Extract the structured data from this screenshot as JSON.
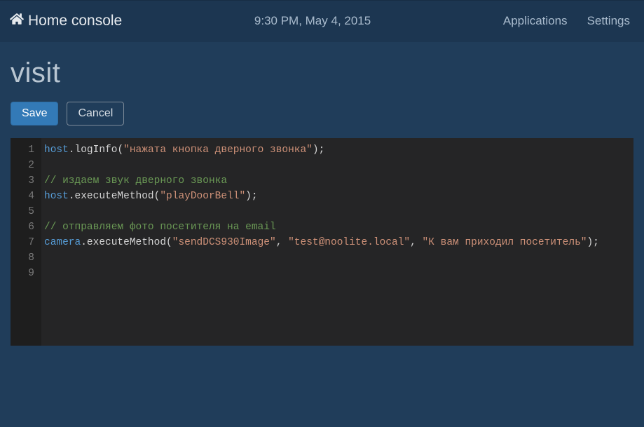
{
  "nav": {
    "brand": "Home console",
    "clock": "9:30 PM, May 4, 2015",
    "links": {
      "applications": "Applications",
      "settings": "Settings"
    }
  },
  "page": {
    "title": "visit",
    "save_label": "Save",
    "cancel_label": "Cancel"
  },
  "code": {
    "lines": [
      {
        "n": 1,
        "segments": [
          {
            "cls": "t-obj",
            "text": "host"
          },
          {
            "cls": "t-punc",
            "text": "."
          },
          {
            "cls": "t-method",
            "text": "logInfo"
          },
          {
            "cls": "t-punc",
            "text": "("
          },
          {
            "cls": "t-str",
            "text": "\"нажата кнопка дверного звонка\""
          },
          {
            "cls": "t-punc",
            "text": ");"
          }
        ]
      },
      {
        "n": 2,
        "segments": []
      },
      {
        "n": 3,
        "segments": [
          {
            "cls": "t-cmt",
            "text": "// издаем звук дверного звонка"
          }
        ]
      },
      {
        "n": 4,
        "segments": [
          {
            "cls": "t-obj",
            "text": "host"
          },
          {
            "cls": "t-punc",
            "text": "."
          },
          {
            "cls": "t-method",
            "text": "executeMethod"
          },
          {
            "cls": "t-punc",
            "text": "("
          },
          {
            "cls": "t-str",
            "text": "\"playDoorBell\""
          },
          {
            "cls": "t-punc",
            "text": ");"
          }
        ]
      },
      {
        "n": 5,
        "segments": []
      },
      {
        "n": 6,
        "segments": [
          {
            "cls": "t-cmt",
            "text": "// отправляем фото посетителя на email"
          }
        ]
      },
      {
        "n": 7,
        "segments": [
          {
            "cls": "t-obj",
            "text": "camera"
          },
          {
            "cls": "t-punc",
            "text": "."
          },
          {
            "cls": "t-method",
            "text": "executeMethod"
          },
          {
            "cls": "t-punc",
            "text": "("
          },
          {
            "cls": "t-str",
            "text": "\"sendDCS930Image\""
          },
          {
            "cls": "t-punc",
            "text": ", "
          },
          {
            "cls": "t-str",
            "text": "\"test@noolite.local\""
          },
          {
            "cls": "t-punc",
            "text": ", "
          },
          {
            "cls": "t-str",
            "text": "\"К вам приходил посетитель\""
          },
          {
            "cls": "t-punc",
            "text": ");"
          }
        ]
      },
      {
        "n": 8,
        "segments": []
      },
      {
        "n": 9,
        "segments": []
      }
    ]
  }
}
